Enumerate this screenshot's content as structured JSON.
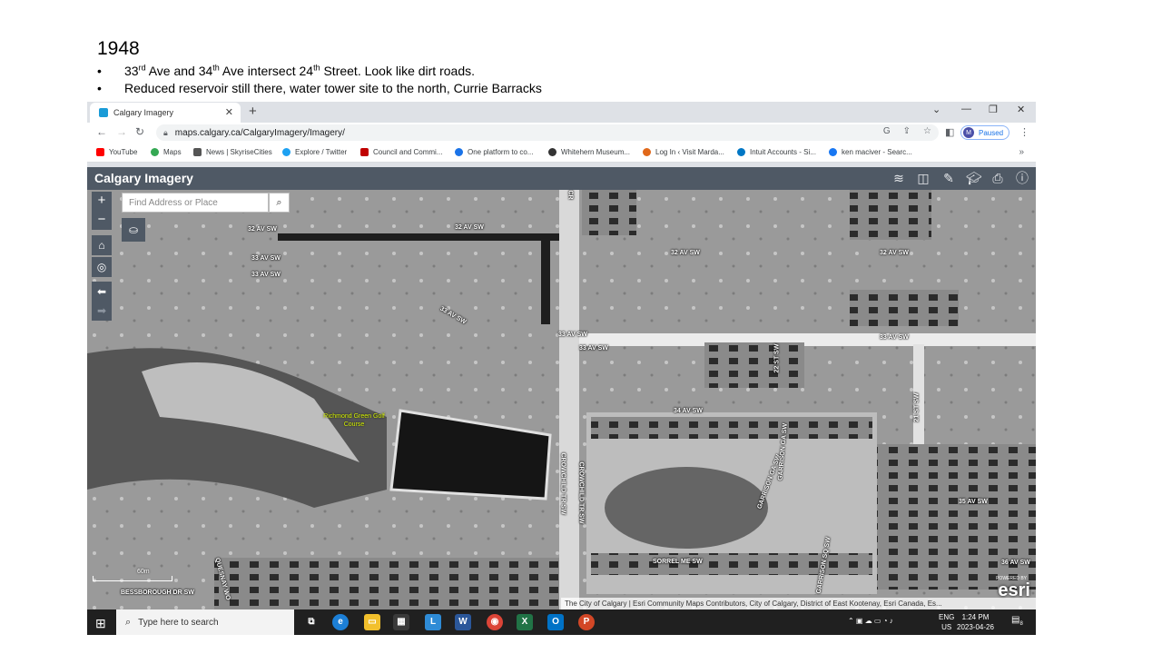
{
  "slide": {
    "title": "1948",
    "bullet1_a": "33",
    "bullet1_sup1": "rd",
    "bullet1_b": " Ave and 34",
    "bullet1_sup2": "th",
    "bullet1_c": " Ave intersect 24",
    "bullet1_sup3": "th",
    "bullet1_d": " Street. Look like dirt roads.",
    "bullet2": "Reduced reservoir still there, water tower site to the north, Currie Barracks",
    "bullet_char": "•"
  },
  "browser": {
    "tab_title": "Calgary Imagery",
    "tab_close": "✕",
    "new_tab": "+",
    "url": "maps.calgary.ca/CalgaryImagery/Imagery/",
    "profile_initial": "M",
    "profile_status": "Paused",
    "bookmarks": [
      {
        "label": "YouTube",
        "color": "#ff0000"
      },
      {
        "label": "Maps",
        "color": "#34a853"
      },
      {
        "label": "News | SkyriseCities",
        "color": "#555555"
      },
      {
        "label": "Explore / Twitter",
        "color": "#1da1f2"
      },
      {
        "label": "Council and Commi...",
        "color": "#c00000"
      },
      {
        "label": "One platform to co...",
        "color": "#1a73e8"
      },
      {
        "label": "Whitehern Museum...",
        "color": "#333333"
      },
      {
        "label": "Log In ‹ Visit Marda...",
        "color": "#e0681a"
      },
      {
        "label": "Intuit Accounts - Si...",
        "color": "#0077c5"
      },
      {
        "label": "ken maciver - Searc...",
        "color": "#1877f2"
      }
    ],
    "bookmarks_more": "»"
  },
  "app": {
    "title": "Calgary Imagery",
    "search_placeholder": "Find Address or Place",
    "zoom_in": "+",
    "zoom_out": "−",
    "scale_label": "60m",
    "attribution": "The City of Calgary | Esri Community Maps Contributors, City of Calgary, District of East Kootenay, Esri Canada, Es...",
    "esri_powered": "POWERED BY",
    "esri_logo": "esri"
  },
  "map_labels": {
    "l1": "32 AV SW",
    "l2": "32 AV SW",
    "l3": "33 AV SW",
    "l4": "33 AV SW",
    "l5": "33 AV SW",
    "l6": "32 AV SW",
    "l7": "32 AV SW",
    "l8": "33 AV SW",
    "l9": "33 AV SW",
    "l10": "33 AV SW",
    "l11": "34 AV SW",
    "l12": "35 AV SW",
    "l13": "36 AV SW",
    "l14": "CROWCHILD TR SW",
    "l15": "CROWCHILD TR SW",
    "l16": "22 ST SW",
    "l17": "21 ST SW",
    "l18": "GARRISON GA SW",
    "l19": "GARRISON GA SW",
    "l20": "SORREL ME SW",
    "l21": "QUESNAY WO",
    "l22": "BESSBOROUGH DR SW",
    "l23": "GARRISON SQ SW",
    "l24": "CR",
    "park": "Richmond Green Golf Course"
  },
  "taskbar": {
    "search_placeholder": "Type here to search",
    "lang": "ENG",
    "region": "US",
    "time": "1:24 PM",
    "date": "2023-04-26",
    "notification_count": "8"
  }
}
